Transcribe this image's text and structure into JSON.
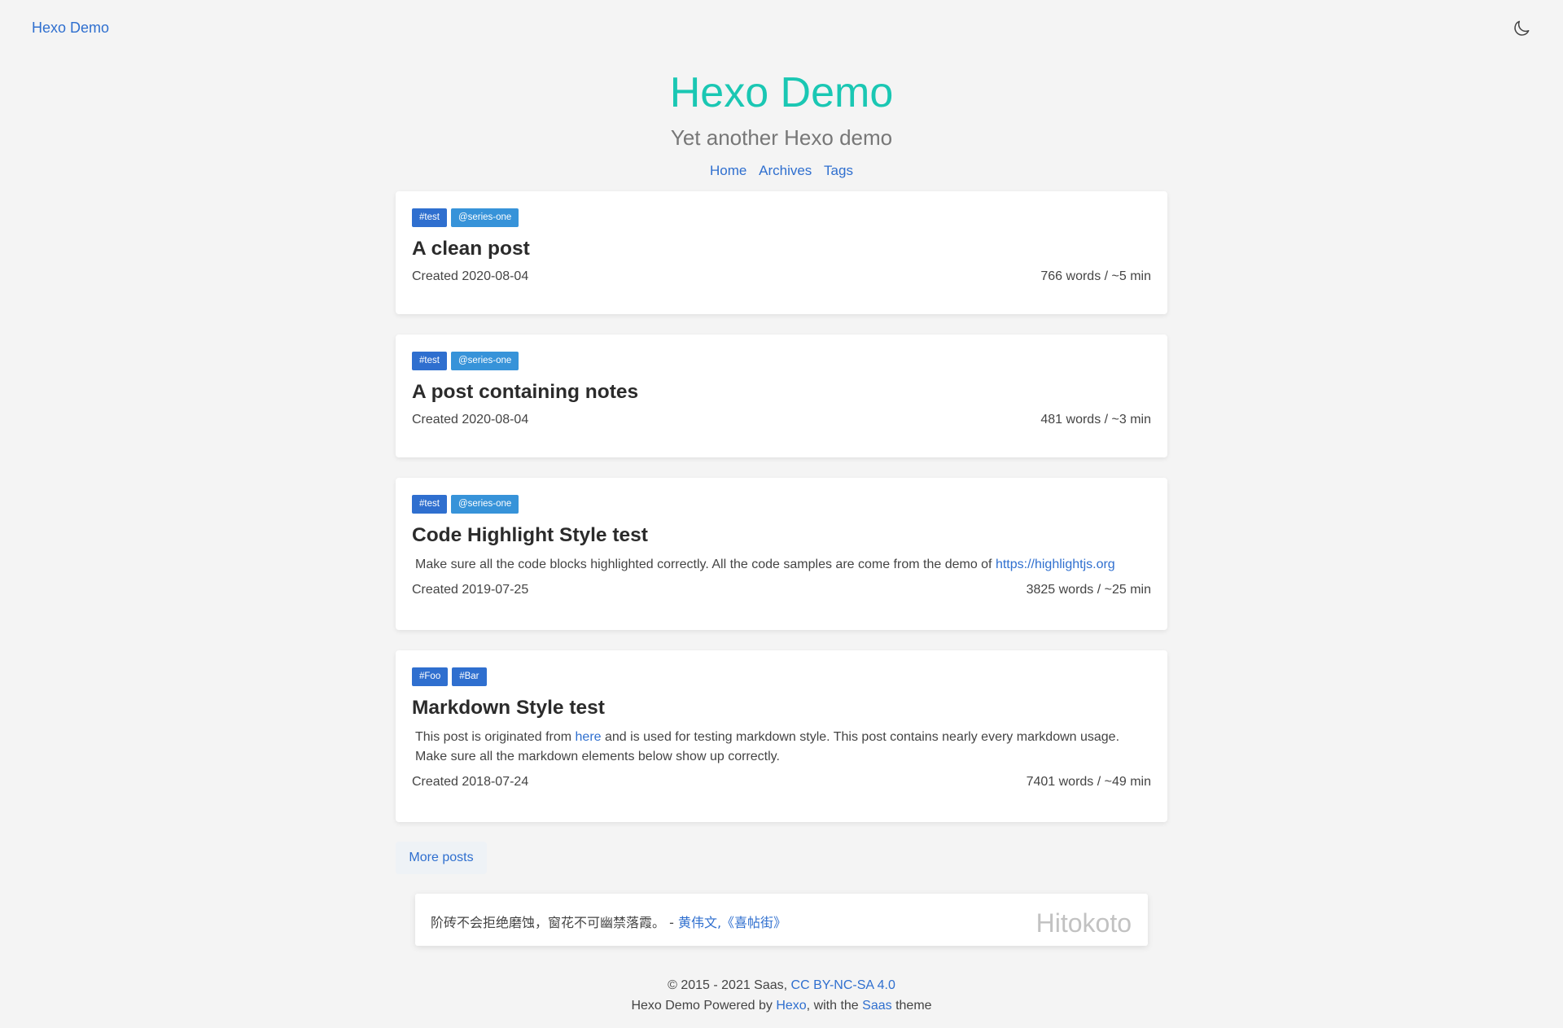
{
  "header": {
    "brand_link": "Hexo Demo",
    "title": "Hexo Demo",
    "subtitle": "Yet another Hexo demo",
    "nav": [
      "Home",
      "Archives",
      "Tags"
    ],
    "theme_toggle_icon": "moon-icon"
  },
  "posts": [
    {
      "tags": [
        "#test",
        "@series-one"
      ],
      "title": "A clean post",
      "excerpt": "",
      "created": "Created 2020-08-04",
      "stats": "766 words / ~5 min"
    },
    {
      "tags": [
        "#test",
        "@series-one"
      ],
      "title": "A post containing notes",
      "excerpt": "",
      "created": "Created 2020-08-04",
      "stats": "481 words / ~3 min"
    },
    {
      "tags": [
        "#test",
        "@series-one"
      ],
      "title": "Code Highlight Style test",
      "excerpt_before": "Make sure all the code blocks highlighted correctly. All the code samples are come from the demo of ",
      "excerpt_link": "https://highlightjs.org",
      "created": "Created 2019-07-25",
      "stats": "3825 words / ~25 min"
    },
    {
      "tags": [
        "#Foo",
        "#Bar"
      ],
      "title": "Markdown Style test",
      "excerpt_before": "This post is originated from ",
      "excerpt_link": "here",
      "excerpt_after": " and is used for testing markdown style. This post contains nearly every markdown usage. Make sure all the markdown elements below show up correctly.",
      "created": "Created 2018-07-24",
      "stats": "7401 words / ~49 min"
    }
  ],
  "more_posts": "More posts",
  "hitokoto": {
    "quote": "阶砖不会拒绝磨蚀，窗花不可幽禁落霞。 - ",
    "source": "黄伟文,《喜帖街》",
    "label": "Hitokoto"
  },
  "footer": {
    "line1_text": "© 2015 - 2021 Saas, ",
    "line1_link": "CC BY-NC-SA 4.0",
    "line2_a": "Hexo Demo Powered by ",
    "line2_link1": "Hexo",
    "line2_b": ", with the ",
    "line2_link2": "Saas",
    "line2_c": " theme"
  }
}
